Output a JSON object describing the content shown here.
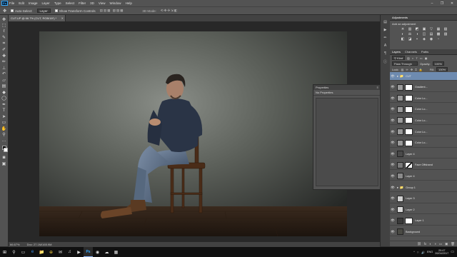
{
  "app": {
    "logo": "Ps"
  },
  "menu": [
    "File",
    "Edit",
    "Image",
    "Layer",
    "Type",
    "Select",
    "Filter",
    "3D",
    "View",
    "Window",
    "Help"
  ],
  "window_controls": [
    "–",
    "❐",
    "✕"
  ],
  "options_bar": {
    "auto_select_label": "Auto-Select:",
    "auto_select_value": "Layer",
    "transform_label": "Show Transform Controls",
    "mode_label": "3D Mode:"
  },
  "document": {
    "tab_title": "CUT.UP @ 66.7% (CUT, RGB/16*) *",
    "zoom": "66.67%",
    "doc_info": "Doc: 27.1M/165.9M"
  },
  "properties": {
    "title": "Properties",
    "subtitle": "No Properties"
  },
  "adjustments": {
    "tab": "Adjustments",
    "title": "Add an adjustment",
    "icons": [
      "☀",
      "▥",
      "◩",
      "▣",
      "▽",
      "▦",
      "▧",
      "◐",
      "⚖",
      "◑",
      "◫",
      "▤",
      "▩",
      "▨",
      "◧",
      "◪",
      "▪",
      "◈",
      "◉",
      "▫"
    ]
  },
  "layers_panel": {
    "tabs": [
      "Layers",
      "Channels",
      "Paths"
    ],
    "kind_label": "Kind",
    "blend_mode": "Pass Through",
    "opacity_label": "Opacity:",
    "opacity_value": "100%",
    "lock_label": "Lock:",
    "fill_label": "Fill:",
    "fill_value": "100%",
    "layers": [
      {
        "name": "CUT",
        "type": "group",
        "selected": true,
        "thumb": ""
      },
      {
        "name": "Gradient...",
        "type": "adjust",
        "thumb": "#9a9a9a"
      },
      {
        "name": "Color Lo...",
        "type": "adjust",
        "thumb": "#9a9a9a"
      },
      {
        "name": "Color Lo...",
        "type": "adjust",
        "thumb": "#9a9a9a"
      },
      {
        "name": "Color Lo...",
        "type": "adjust",
        "thumb": "#9a9a9a"
      },
      {
        "name": "Color Lo...",
        "type": "adjust",
        "thumb": "#9a9a9a"
      },
      {
        "name": "Color Lo...",
        "type": "adjust",
        "thumb": "#9a9a9a"
      },
      {
        "name": "Layer 4",
        "type": "pixel",
        "thumb": "#4a4a4a"
      },
      {
        "name": "Face Offshand",
        "type": "masked",
        "thumb": "#7a7a7a"
      },
      {
        "name": "Layer 4",
        "type": "pixel",
        "thumb": "#8a8a8a"
      },
      {
        "name": "Group 1",
        "type": "group",
        "thumb": ""
      },
      {
        "name": "Layer 3",
        "type": "pixel",
        "thumb": "#d0d0d0"
      },
      {
        "name": "Layer 2",
        "type": "pixel",
        "thumb": "#d8d8d8"
      },
      {
        "name": "Layer 1",
        "type": "masked",
        "thumb": "#3a3a3a"
      },
      {
        "name": "Background",
        "type": "pixel",
        "thumb": "#4a4a44"
      }
    ],
    "footer_icons": [
      "⛓",
      "fx",
      "◐",
      "◑",
      "▭",
      "▣",
      "🗑"
    ]
  },
  "status": {
    "zoom": "66.67%",
    "doc": "Doc: 27.1M/165.9M"
  },
  "taskbar": {
    "icons": [
      "⊞",
      "⚲",
      "▭",
      "e",
      "📁",
      "⊕",
      "✉",
      "♫",
      "▶",
      "Ps",
      "◉",
      "☁",
      "▦"
    ],
    "tray": [
      "^",
      "⚐",
      "🔊",
      "ENG"
    ],
    "time": "20:47",
    "date": "26/04/2017"
  },
  "colors": {
    "ui_dark": "#535353",
    "canvas_bg": "#282828",
    "selection": "#6e8bb0",
    "taskbar": "#101010"
  }
}
